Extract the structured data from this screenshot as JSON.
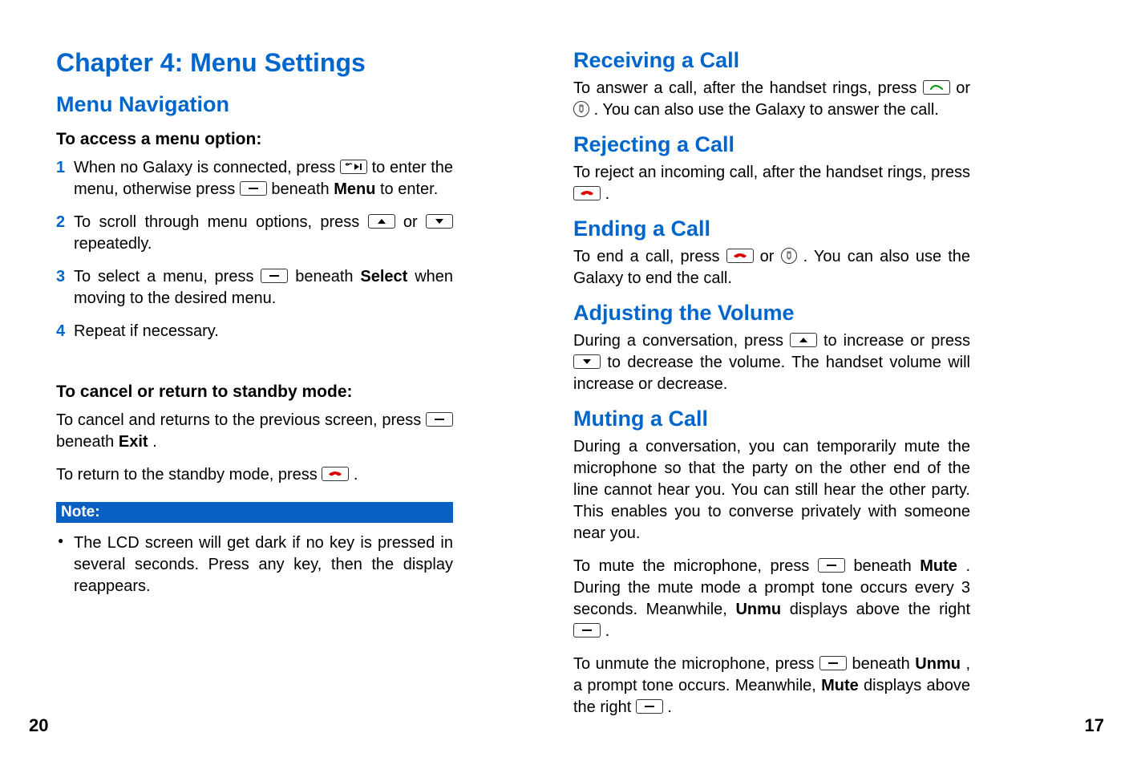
{
  "left": {
    "chapter": "Chapter 4: Menu Settings",
    "section": "Menu Navigation",
    "sub1": "To access a menu option:",
    "steps": {
      "s1a": "When no Galaxy is connected, press ",
      "s1b": " to enter the menu, otherwise press ",
      "s1c": " beneath ",
      "s1d": "Menu",
      "s1e": " to enter.",
      "s2a": "To scroll through menu options, press ",
      "s2b": " or ",
      "s2c": " repeatedly.",
      "s3a": "To select a menu, press ",
      "s3b": " beneath ",
      "s3c": "Select",
      "s3d": " when moving to the desired menu.",
      "s4": "Repeat if necessary."
    },
    "sub2": "To cancel or return to standby mode:",
    "cancel": {
      "a": "To cancel and returns to the previous screen, press ",
      "b": " beneath ",
      "c": "Exit",
      "d": "."
    },
    "standby": {
      "a": "To return to the standby mode, press ",
      "b": " ."
    },
    "noteLabel": "Note:",
    "noteBullet": "The LCD screen will get dark if no key is pressed in several seconds. Press any key, then the display reappears.",
    "pagenum": "20"
  },
  "right": {
    "recv": {
      "title": "Receiving a Call",
      "a": "To answer a call, after the handset rings, press ",
      "b": " or ",
      "c": " . You can also use the Galaxy to answer the call."
    },
    "reject": {
      "title": "Rejecting a Call",
      "a": "To reject an incoming call, after the handset rings, press ",
      "b": " ."
    },
    "end": {
      "title": "Ending a Call",
      "a": "To end a call, press ",
      "b": " or ",
      "c": " . You can also use the Galaxy to end the call."
    },
    "vol": {
      "title": "Adjusting the Volume",
      "a": "During a conversation, press ",
      "b": " to increase or press ",
      "c": " to decrease the volume. The handset volume will increase or decrease."
    },
    "mute": {
      "title": "Muting a Call",
      "p1": "During a conversation, you can temporarily mute the microphone so that the party on the other end of the line cannot hear you. You can still hear the other party. This enables you to converse privately with someone near you.",
      "p2a": "To mute the microphone, press ",
      "p2b": " beneath ",
      "p2c": "Mute",
      "p2d": ". During the mute mode a prompt tone occurs every 3 seconds. Meanwhile, ",
      "p2e": "Unmu",
      "p2f": " displays above the right ",
      "p2g": " .",
      "p3a": "To unmute the microphone, press ",
      "p3b": " beneath ",
      "p3c": "Unmu",
      "p3d": ", a prompt tone occurs. Meanwhile, ",
      "p3e": "Mute",
      "p3f": " displays above the right ",
      "p3g": " ."
    },
    "pagenum": "17"
  }
}
